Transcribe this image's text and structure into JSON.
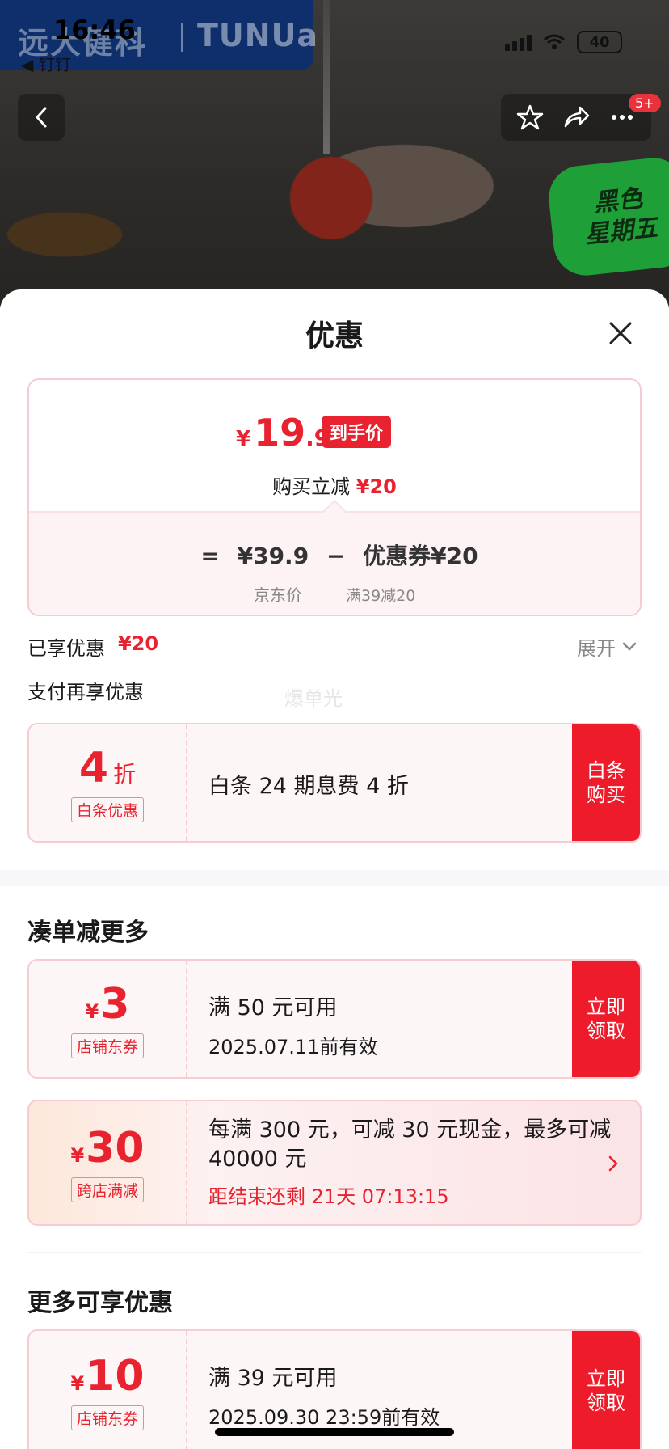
{
  "status_bar": {
    "time": "16:46",
    "back_app": "◀ 钉钉",
    "battery": "40"
  },
  "brand": {
    "name": "远大健科",
    "logo": "TUNUa"
  },
  "nav": {
    "badge": "5+"
  },
  "promo_badge": {
    "line1": "黑色",
    "line2": "星期五"
  },
  "sheet": {
    "title": "优惠"
  },
  "price_card": {
    "currency": "¥",
    "final_int": "19",
    "final_dec": ".9",
    "tag": "到手价",
    "reduce_label": "购买立减",
    "reduce_amount": "¥20",
    "formula_eq": "=",
    "jd_price": "¥39.9",
    "minus": "−",
    "coupon_part": "优惠券¥20",
    "jd_price_label": "京东价",
    "coupon_condition": "满39减20"
  },
  "enjoyed": {
    "label": "已享优惠",
    "amount": "¥20",
    "expand": "展开"
  },
  "pay_more": {
    "label": "支付再享优惠",
    "watermark": "爆单光"
  },
  "baitiao": {
    "amount": "4",
    "unit": "折",
    "tag": "白条优惠",
    "title": "白条 24 期息费 4 折",
    "cta": "白条购买"
  },
  "combine_section": {
    "title": "凑单减更多"
  },
  "coupon_3": {
    "currency": "¥",
    "amount": "3",
    "tag": "店铺东券",
    "title": "满 50 元可用",
    "validity": "2025.07.11前有效",
    "cta": "立即领取"
  },
  "coupon_30": {
    "currency": "¥",
    "amount": "30",
    "tag": "跨店满减",
    "title": "每满 300 元，可减 30 元现金，最多可减 40000 元",
    "countdown": "距结束还剩 21天 07:13:15"
  },
  "more_section": {
    "title": "更多可享优惠"
  },
  "coupon_10": {
    "currency": "¥",
    "amount": "10",
    "tag": "店铺东券",
    "title": "满 39 元可用",
    "validity": "2025.09.30 23:59前有效",
    "cta": "立即领取"
  },
  "colors": {
    "accent_red": "#e8232f",
    "cta_red": "#ee1b2a",
    "brand_navy": "#0e2f6b",
    "promo_green": "#1f9f37"
  }
}
